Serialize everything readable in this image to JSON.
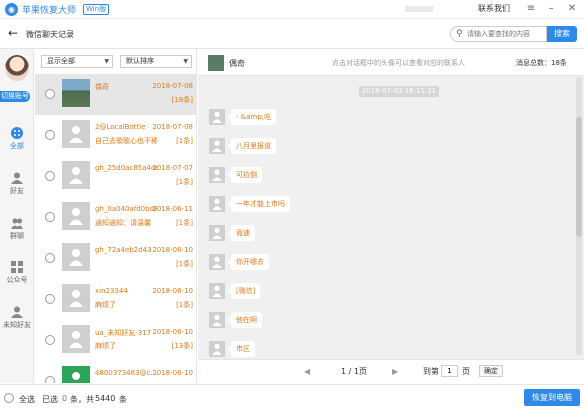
{
  "titlebar": {
    "app_name": "苹果恢复大师",
    "badge": "Win版",
    "contact": "联系我们",
    "logo_glyph": "◉"
  },
  "pagebar": {
    "back_glyph": "←",
    "title": "微信聊天记录",
    "search_placeholder": "请输入要查找的内容",
    "search_btn": "搜索"
  },
  "sidebar": {
    "switch_label": "切换账号",
    "items": [
      {
        "label": "全部",
        "icon": "grid-dots-icon"
      },
      {
        "label": "好友",
        "icon": "person-icon"
      },
      {
        "label": "群聊",
        "icon": "group-icon"
      },
      {
        "label": "公众号",
        "icon": "squares-icon"
      },
      {
        "label": "未知好友",
        "icon": "unknown-person-icon"
      }
    ]
  },
  "filters": {
    "show": "显示全部",
    "sort": "默认排序"
  },
  "contacts": [
    {
      "name": "偶奇",
      "date": "2018-07-08",
      "msg": "",
      "count": "[18条]"
    },
    {
      "name": "2@LocalBottle",
      "date": "2018-07-08",
      "msg": "自己去歌歌心也不稀",
      "count": "[1条]"
    },
    {
      "name": "gh_25d0ac85a4oc",
      "date": "2018-07-07",
      "msg": "",
      "count": "[1条]"
    },
    {
      "name": "gh_0a040afd0bd8",
      "date": "2018-06-11",
      "msg": "通知通知：请温馨",
      "count": "[1条]"
    },
    {
      "name": "gh_72a4eb2d43",
      "date": "2018-06-10",
      "msg": "",
      "count": "[1条]"
    },
    {
      "name": "xin23344",
      "date": "2018-06-10",
      "msg": "麻烦了",
      "count": "[1条]"
    },
    {
      "name": "ua_未知好友-317",
      "date": "2018-06-10",
      "msg": "麻烦了",
      "count": "[13条]"
    },
    {
      "name": "4800373463@c...",
      "date": "2018-06-10",
      "msg": "",
      "count": ""
    }
  ],
  "chat": {
    "name": "偶奇",
    "hint": "点击对话框中的头像可以查看对应的联系人",
    "total": "消息总数：18条",
    "time": "2018-07-03 16:11:21",
    "messages": [
      "- &amp;吃",
      "八月里报道",
      "可拉倒",
      "一年才能上市吗",
      "竟速",
      "你开哪去",
      "[微信]",
      "他在啊",
      "市区"
    ]
  },
  "pager": {
    "page": "1 / 1页",
    "goto_label": "到第",
    "page_unit": "页",
    "page_value": "1",
    "confirm": "确定",
    "prev": "◀",
    "next": "▶"
  },
  "footer": {
    "select_all": "全选",
    "selected_prefix": "已选",
    "selected_count": "0",
    "selected_mid": "条，共",
    "total_count": "5440",
    "selected_suffix": "条",
    "restore": "恢复到电脑"
  },
  "colors": {
    "accent": "#2e8ae6",
    "highlight": "#e07a18"
  }
}
